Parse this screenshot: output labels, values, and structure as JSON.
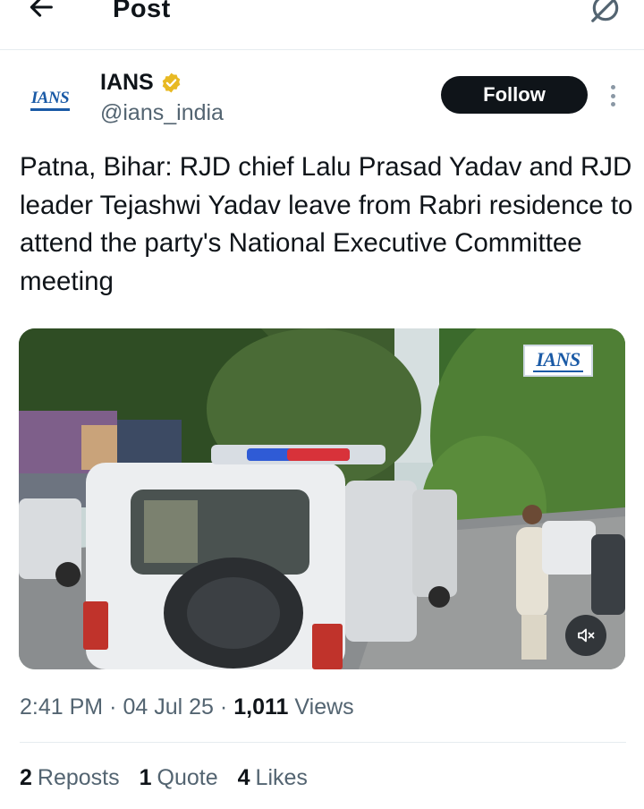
{
  "header": {
    "title": "Post",
    "back_icon": "arrow-left-icon",
    "grok_icon": "grok-icon"
  },
  "author": {
    "display_name": "IANS",
    "handle": "@ians_india",
    "avatar_text": "IANS",
    "verified_color": "#e8b923",
    "follow_label": "Follow"
  },
  "post": {
    "text": "Patna, Bihar: RJD chief Lalu Prasad Yadav and RJD leader Tejashwi Yadav leave from Rabri residence to attend the party's National Executive Committee meeting"
  },
  "media": {
    "type": "video",
    "watermark": "IANS",
    "mute_icon": "speaker-muted-icon"
  },
  "meta": {
    "time": "2:41 PM",
    "separator": "·",
    "date": "04 Jul 25",
    "views_count": "1,011",
    "views_label": "Views"
  },
  "stats": {
    "reposts_count": "2",
    "reposts_label": "Reposts",
    "quotes_count": "1",
    "quotes_label": "Quote",
    "likes_count": "4",
    "likes_label": "Likes"
  },
  "colors": {
    "text_primary": "#0f1419",
    "text_secondary": "#536471",
    "follow_bg": "#0f1419",
    "divider": "#e6ecf0"
  }
}
